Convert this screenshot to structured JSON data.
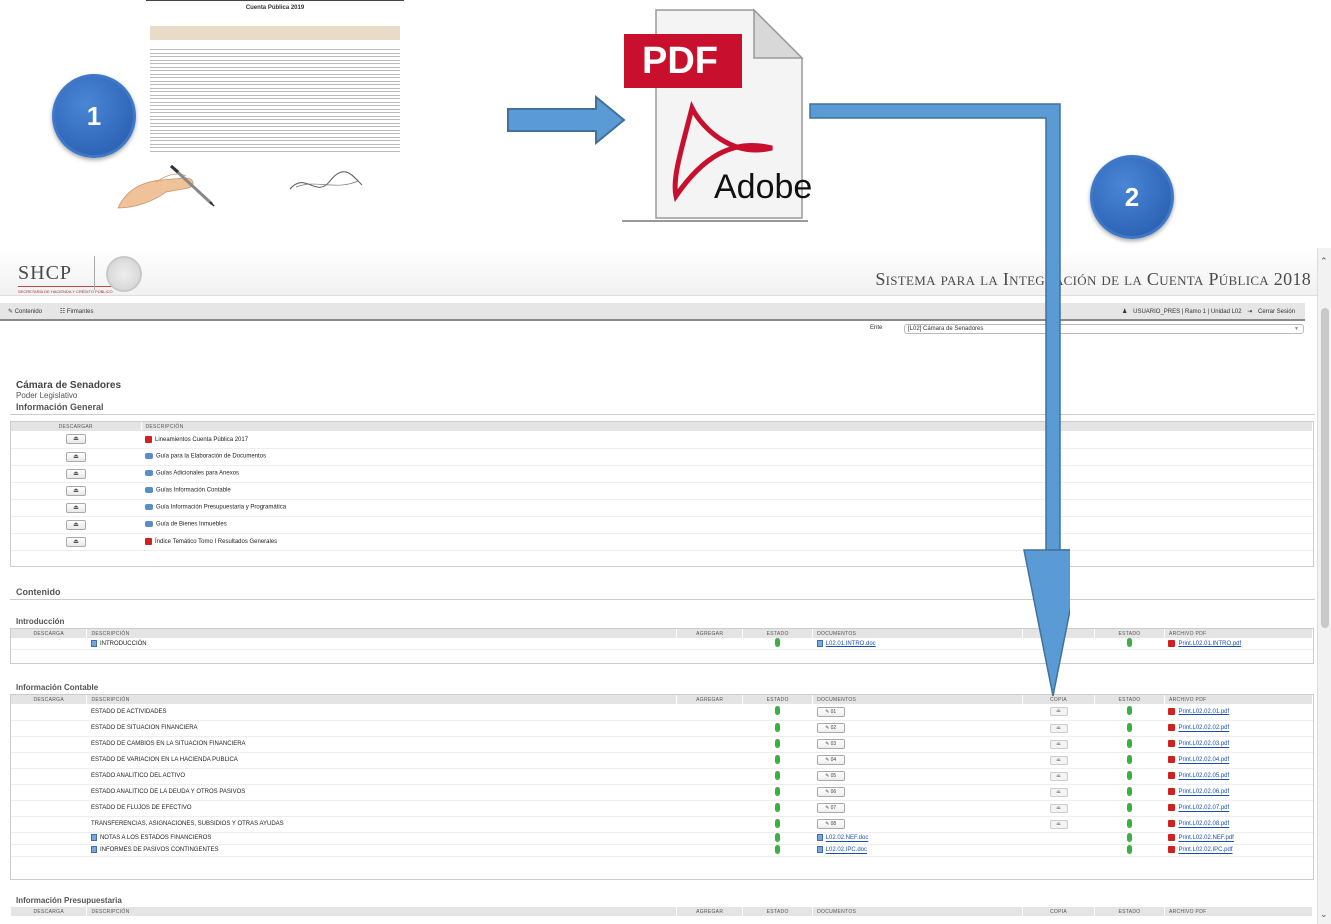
{
  "overlay": {
    "step1": "1",
    "step2": "2",
    "doc_title": "Cuenta Pública 2019",
    "pdf_badge": "PDF",
    "pdf_brand": "Adobe"
  },
  "app": {
    "logo_text": "SHCP",
    "logo_subtext": "SECRETARÍA DE HACIENDA Y CRÉDITO PÚBLICO",
    "system_title": "Sistema para la Integración de la Cuenta Pública 2018",
    "nav": {
      "contenido": "Contenido",
      "firmantes": "Firmantes",
      "user": "USUARIO_PRES | Ramo 1 | Unidad L02",
      "logout": "Cerrar Sesión"
    },
    "ente_label": "Ente",
    "ente_value": "[L02] Cámara de Senadores",
    "entity_name": "Cámara de Senadores",
    "entity_sub": "Poder Legislativo",
    "info_general": {
      "title": "Información General",
      "headers": [
        "Descargar",
        "Descripción"
      ],
      "rows": [
        {
          "icon": "pdf",
          "label": "Lineamientos Cuenta Pública 2017"
        },
        {
          "icon": "drive",
          "label": "Guía para la Elaboración de Documentos"
        },
        {
          "icon": "drive",
          "label": "Guías Adicionales para Anexos"
        },
        {
          "icon": "drive",
          "label": "Guías Información Contable"
        },
        {
          "icon": "drive",
          "label": "Guía Información Presupuestaria y Programática"
        },
        {
          "icon": "drive",
          "label": "Guía de Bienes Inmuebles"
        },
        {
          "icon": "pdf",
          "label": "Índice Temático Tomo I Resultados Generales"
        }
      ]
    },
    "contenido_title": "Contenido",
    "intro": {
      "title": "Introducción",
      "headers": [
        "Descarga",
        "Descripción",
        "Agregar",
        "Estado",
        "Documentos",
        "",
        "Estado",
        "Archivo PDF"
      ],
      "rows": [
        {
          "desc": "INTRODUCCIÓN",
          "doc": "L02.01.INTRO.doc",
          "pdf": "Print.L02.01.INTRO.pdf"
        }
      ]
    },
    "contable": {
      "title": "Información Contable",
      "headers": [
        "Descarga",
        "Descripción",
        "Agregar",
        "Estado",
        "Documentos",
        "Copia",
        "Estado",
        "Archivo PDF"
      ],
      "rows": [
        {
          "desc": "ESTADO DE ACTIVIDADES",
          "doc": "01",
          "pdf": "Print.L02.02.01.pdf"
        },
        {
          "desc": "ESTADO DE SITUACION FINANCIERA",
          "doc": "02",
          "pdf": "Print.L02.02.02.pdf"
        },
        {
          "desc": "ESTADO DE CAMBIOS EN LA SITUACION FINANCIERA",
          "doc": "03",
          "pdf": "Print.L02.02.03.pdf"
        },
        {
          "desc": "ESTADO DE VARIACION EN LA HACIENDA PUBLICA",
          "doc": "04",
          "pdf": "Print.L02.02.04.pdf"
        },
        {
          "desc": "ESTADO ANALITICO DEL ACTIVO",
          "doc": "05",
          "pdf": "Print.L02.02.05.pdf"
        },
        {
          "desc": "ESTADO ANALITICO DE LA DEUDA Y OTROS PASIVOS",
          "doc": "06",
          "pdf": "Print.L02.02.06.pdf"
        },
        {
          "desc": "ESTADO DE FLUJOS DE EFECTIVO",
          "doc": "07",
          "pdf": "Print.L02.02.07.pdf"
        },
        {
          "desc": "TRANSFERENCIAS, ASIGNACIONES, SUBSIDIOS Y OTRAS AYUDAS",
          "doc": "08",
          "pdf": "Print.L02.02.08.pdf"
        }
      ],
      "link_rows": [
        {
          "desc": "NOTAS A LOS ESTADOS FINANCIEROS",
          "doc": "L02.02.NEF.doc",
          "pdf": "Print.L02.02.NEF.pdf"
        },
        {
          "desc": "INFORMES DE PASIVOS CONTINGENTES",
          "doc": "L02.02.IPC.doc",
          "pdf": "Print.L02.02.IPC.pdf"
        }
      ]
    },
    "presupuestaria": {
      "title": "Información Presupuestaria",
      "headers": [
        "Descarga",
        "Descripción",
        "Agregar",
        "Estado",
        "Documentos",
        "Copia",
        "Estado",
        "Archivo PDF"
      ]
    },
    "colors": {
      "status_green": "#3cb043",
      "arrow_blue": "#5b9bd5",
      "circle_blue": "#2f66b8",
      "pdf_red": "#d12020"
    },
    "icons": [
      "pdf-file-icon",
      "drive-icon",
      "download-icon",
      "edit-icon",
      "word-doc-icon",
      "user-icon",
      "logout-icon"
    ]
  }
}
